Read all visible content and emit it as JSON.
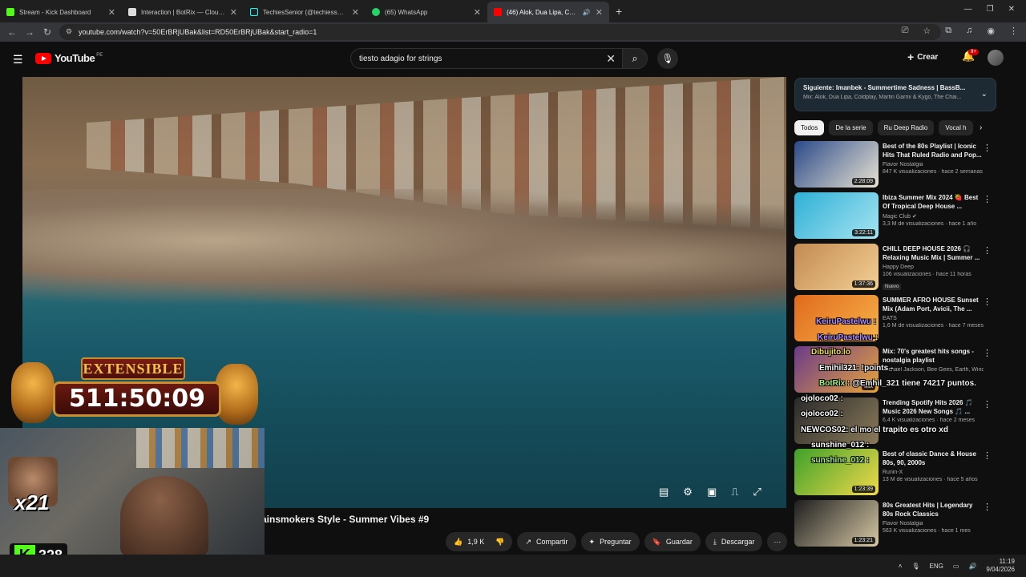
{
  "browser": {
    "tabs": [
      {
        "title": "Stream - Kick Dashboard",
        "color": "#53fc18"
      },
      {
        "title": "Interaction | BotRix — Cloud St",
        "color": "#ffffff"
      },
      {
        "title": "TechiesSenior (@techiessenior_",
        "color": "#ffffff"
      },
      {
        "title": "(65) WhatsApp",
        "color": "#25d366"
      },
      {
        "title": "(46) Alok, Dua Lipa, Coldpl",
        "color": "#ff0000"
      }
    ],
    "new_tab": "+",
    "url": "youtube.com/watch?v=50ErBRjUBak&list=RD50ErBRjUBak&start_radio=1"
  },
  "youtube": {
    "logo_text": "YouTube",
    "region": "PE",
    "search_value": "tiesto adagio for strings",
    "create_label": "Crear",
    "notif_count": "9+",
    "video_title": "ainsmokers Style - Summer Vibes #9",
    "actions": {
      "likes": "1,9 K",
      "share": "Compartir",
      "ask": "Preguntar",
      "save": "Guardar",
      "download": "Descargar"
    },
    "next": {
      "title": "Siguiente: Imanbek - Summertime Sadness | BassB...",
      "sub": "Mix: Alok, Dua Lipa, Coldplay, Martin Garrix & Kygo, The Chai..."
    },
    "chips": [
      "Todos",
      "De la serie",
      "Ru Deep Radio",
      "Vocal h"
    ],
    "playlist": [
      {
        "title": "Best of the 80s Playlist | Iconic Hits That Ruled Radio and Pop...",
        "channel": "Flavor Nostalgia",
        "meta": "847 K visualizaciones · hace 2 semanas",
        "dur": "2:28:09",
        "c1": "#2b4a8a",
        "c2": "#e9e3d2"
      },
      {
        "title": "Ibiza Summer Mix 2024 🍓 Best Of Tropical Deep House ...",
        "channel": "Magic Club ✔",
        "meta": "3,3 M de visualizaciones · hace 1 año",
        "dur": "3:22:11",
        "c1": "#2fb0d6",
        "c2": "#a6e4f2"
      },
      {
        "title": "CHILL DEEP HOUSE 2026 🎧 Relaxing Music Mix | Summer ...",
        "channel": "Happy Deep",
        "meta": "106 visualizaciones · hace 11 horas",
        "dur": "1:37:36",
        "c1": "#c28b52",
        "c2": "#f4cf94",
        "badge": "Nuevo"
      },
      {
        "title": "SUMMER AFRO HOUSE Sunset Mix (Adam Port, Avicii, The ...",
        "channel": "EATS",
        "meta": "1,6 M de visualizaciones · hace 7 meses",
        "dur": "",
        "c1": "#e06a1c",
        "c2": "#f7b24a"
      },
      {
        "title": "Mix: 70's greatest hits songs - nostalgia playlist",
        "channel": "Michael Jackson, Bee Gees, Earth, Wind ...",
        "meta": "",
        "dur": "Mix",
        "c1": "#6a3a8a",
        "c2": "#e8a43a"
      },
      {
        "title": "Trending Spotify Hits 2026 🎵 Music 2026 New Songs 🎵 ...",
        "channel": "",
        "meta": "6,4 K visualizaciones · hace 2 meses",
        "dur": "",
        "c1": "#2a2a2a",
        "c2": "#8a7a5a"
      },
      {
        "title": "Best of classic Dance & House 80s, 90, 2000s",
        "channel": "Runin-X",
        "meta": "13 M de visualizaciones · hace 5 años",
        "dur": "1:23:39",
        "c1": "#3ea12a",
        "c2": "#f2d94a"
      },
      {
        "title": "80s Greatest Hits | Legendary 80s Rock Classics",
        "channel": "Flavor Nostalgia",
        "meta": "563 K visualizaciones · hace 1 mes",
        "dur": "1:23:21",
        "c1": "#1e1e1e",
        "c2": "#d8c9a6"
      }
    ]
  },
  "stream_overlay": {
    "banner": "EXTENSIBLE",
    "timer": "511:50:09",
    "multiplier": "x21",
    "kick_logo": "K",
    "viewers": "328",
    "chat": [
      {
        "user": "KeiruPastelwu",
        "msg": ":",
        "color": "p"
      },
      {
        "user": "KeiruPastelwu",
        "msg": ":",
        "color": "p"
      },
      {
        "user": "Dibujito.lo",
        "msg": "",
        "color": "y"
      },
      {
        "user": "Emihil321",
        "msg": ": !points - ",
        "color": "w"
      },
      {
        "user": "BotRix",
        "msg": ": @Emhil_321 tiene 74217 puntos.",
        "color": "g"
      },
      {
        "user": "ojoloco02",
        "msg": ":",
        "color": "w"
      },
      {
        "user": "ojoloco02",
        "msg": ":",
        "color": "w"
      },
      {
        "user": "NEWCOS02",
        "msg": ": el mo el trapito es otro xd",
        "color": "w"
      },
      {
        "user": "sunshine_012",
        "msg": ":",
        "color": "w"
      },
      {
        "user": "sunshine_012",
        "msg": ":",
        "color": "g"
      }
    ]
  },
  "taskbar": {
    "lang": "ENG",
    "time": "11:19",
    "date": "9/04/2026"
  }
}
